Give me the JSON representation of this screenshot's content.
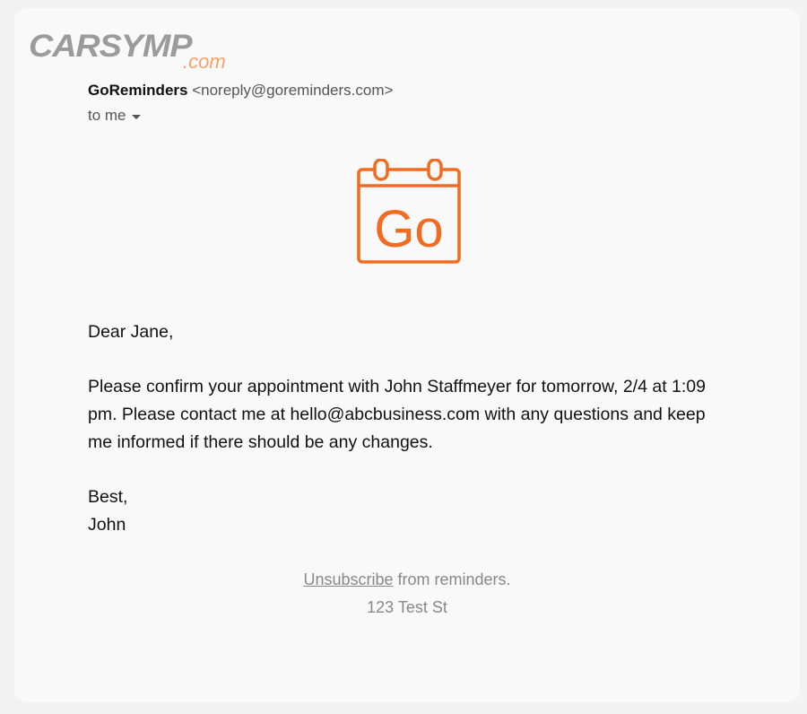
{
  "watermark": {
    "main": "CARSYMP",
    "sub": ".com"
  },
  "email": {
    "sender_name": "GoReminders",
    "sender_address": "<noreply@goreminders.com>",
    "recipient_label": "to me",
    "logo_text": "Go",
    "greeting": "Dear Jane,",
    "message": "Please confirm your appointment with John Staffmeyer for tomorrow, 2/4 at 1:09 pm. Please contact me at hello@abcbusiness.com with any questions and keep me informed if there should be any changes.",
    "signoff_line1": "Best,",
    "signoff_line2": "John"
  },
  "footer": {
    "unsubscribe_link": "Unsubscribe",
    "unsubscribe_suffix": " from reminders.",
    "address": "123 Test St"
  },
  "colors": {
    "accent": "#f26b21",
    "page_background": "#f2f2f2",
    "card_background": "#f9f9f9",
    "watermark_gray": "#9b9b9b",
    "watermark_orange": "#f7a06a"
  },
  "icons": {
    "logo": "calendar-icon",
    "recipient_toggle": "caret-down-icon"
  }
}
